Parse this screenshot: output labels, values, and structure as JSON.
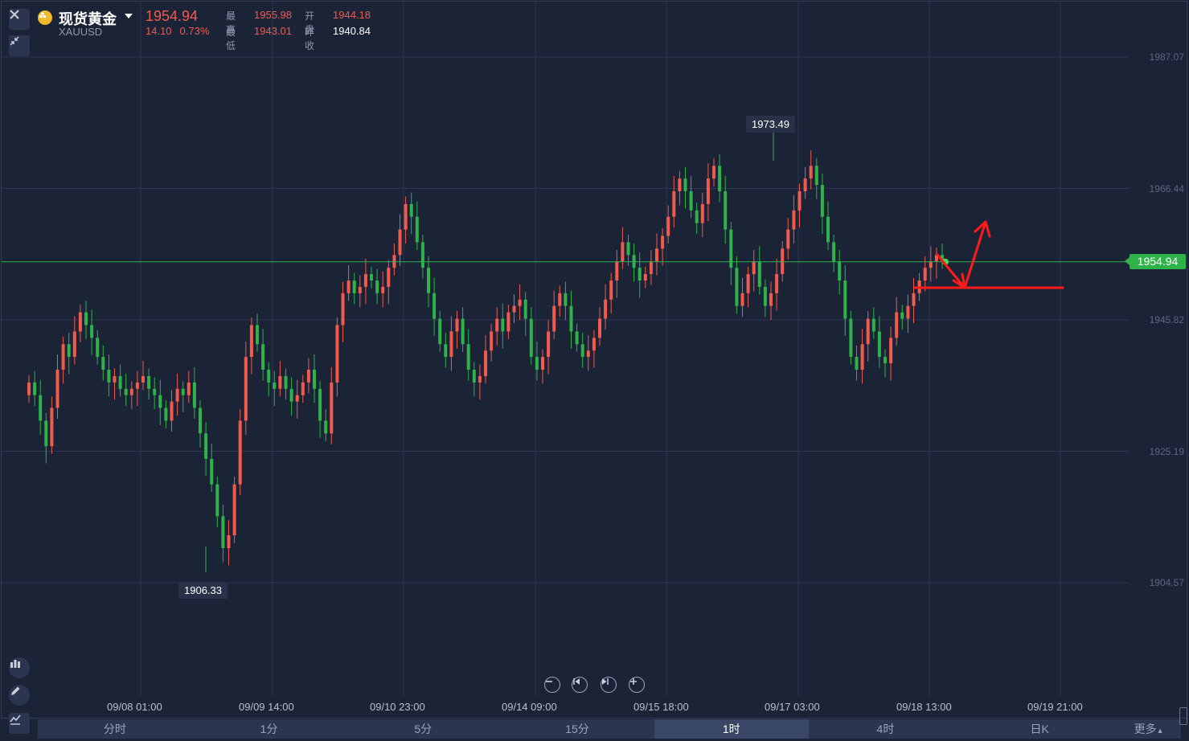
{
  "symbol": {
    "name": "现货黄金",
    "code": "XAUUSD",
    "price": "1954.94",
    "change": "14.10",
    "change_pct": "0.73%",
    "stats": {
      "high_label": "最高",
      "high": "1955.98",
      "open_label": "开盘",
      "open": "1944.18",
      "low_label": "最低",
      "low": "1943.01",
      "prev_close_label": "昨收",
      "prev_close": "1940.84"
    }
  },
  "colors": {
    "up": "#f25a4e",
    "down": "#2fb24a",
    "background": "#1b2337",
    "grid": "#2d3650",
    "annotation": "#ff1a1a"
  },
  "icons": {
    "close": "close-icon",
    "shrink": "shrink-icon",
    "coin": "gold-coin-icon",
    "zoom_out": "zoom-out-icon",
    "step_back": "step-back-icon",
    "step_forward": "step-forward-icon",
    "zoom_in": "zoom-in-icon",
    "indicator": "indicator-icon",
    "draw": "pencil-icon",
    "chart_style": "chart-style-icon"
  },
  "chart_data": {
    "type": "candlestick",
    "y_axis": {
      "labels": [
        "1987.07",
        "1966.44",
        "1945.82",
        "1925.19",
        "1904.57"
      ],
      "range": [
        1898,
        1995
      ]
    },
    "x_axis": {
      "labels": [
        "09/08 01:00",
        "09/09 14:00",
        "09/10 23:00",
        "09/14 09:00",
        "09/15 18:00",
        "09/17 03:00",
        "09/18 13:00",
        "09/19 21:00"
      ]
    },
    "last_price": "1954.94",
    "high_marker": "1973.49",
    "low_marker": "1906.33",
    "grid": true,
    "closes": [
      1936,
      1934,
      1930,
      1926,
      1932,
      1938,
      1942,
      1940,
      1944,
      1947,
      1945,
      1943,
      1940,
      1938,
      1936,
      1937,
      1935,
      1934,
      1935,
      1936,
      1937,
      1935,
      1934,
      1932,
      1930,
      1933,
      1935,
      1934,
      1936,
      1932,
      1928,
      1924,
      1920,
      1915,
      1910,
      1912,
      1920,
      1930,
      1940,
      1945,
      1942,
      1938,
      1936,
      1935,
      1937,
      1935,
      1933,
      1934,
      1936,
      1938,
      1935,
      1930,
      1928,
      1936,
      1945,
      1950,
      1952,
      1950,
      1951,
      1953,
      1952,
      1950,
      1951,
      1954,
      1956,
      1960,
      1964,
      1962,
      1958,
      1954,
      1950,
      1946,
      1942,
      1940,
      1944,
      1946,
      1942,
      1938,
      1936,
      1937,
      1941,
      1944,
      1946,
      1944,
      1947,
      1948,
      1949,
      1946,
      1940,
      1938,
      1940,
      1944,
      1948,
      1950,
      1948,
      1944,
      1942,
      1940,
      1941,
      1943,
      1946,
      1949,
      1952,
      1955,
      1958,
      1956,
      1954,
      1952,
      1953,
      1955,
      1957,
      1959,
      1962,
      1966,
      1968,
      1966,
      1963,
      1961,
      1964,
      1968,
      1970,
      1966,
      1960,
      1954,
      1948,
      1950,
      1953,
      1955,
      1951,
      1948,
      1950,
      1953,
      1957,
      1960,
      1963,
      1966,
      1968,
      1970,
      1967,
      1962,
      1958,
      1955,
      1952,
      1946,
      1940,
      1938,
      1942,
      1946,
      1944,
      1940,
      1939,
      1943,
      1947,
      1946,
      1948,
      1950,
      1952,
      1954,
      1955,
      1956,
      1955
    ]
  },
  "annotation": {
    "label": "red-hand-drawn-arrows"
  },
  "toolbar": {
    "zoom_out": "−",
    "tabs": [
      "分时",
      "1分",
      "5分",
      "15分",
      "1时",
      "4时",
      "日K"
    ],
    "active_tab": "1时",
    "more": "更多"
  }
}
